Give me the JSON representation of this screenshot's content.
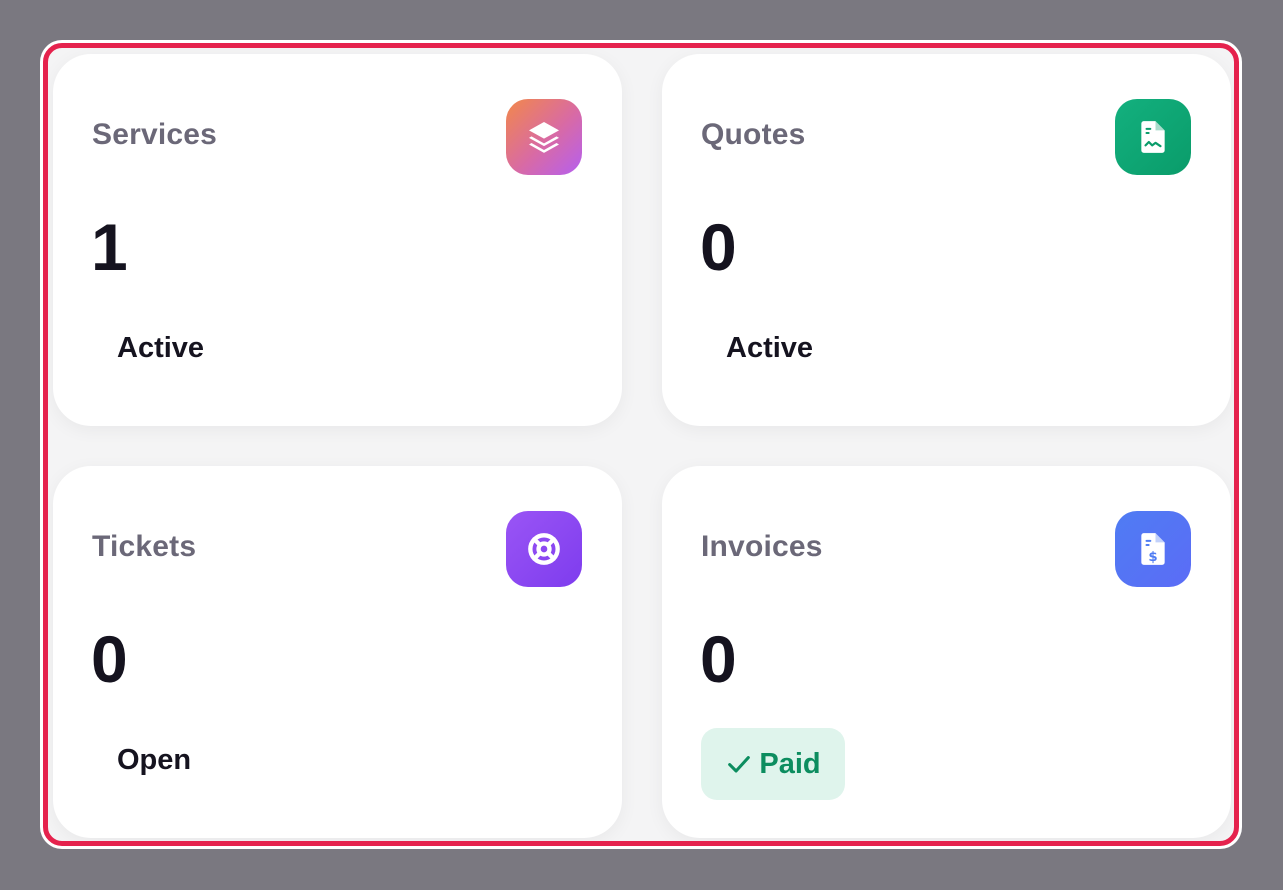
{
  "cards": {
    "services": {
      "title": "Services",
      "count": "1",
      "status": "Active",
      "icon": "layers-icon",
      "accent": [
        "#f2884a",
        "#b55ff0"
      ]
    },
    "quotes": {
      "title": "Quotes",
      "count": "0",
      "status": "Active",
      "icon": "document-chart-icon",
      "accent": [
        "#13b07e",
        "#0a9c6a"
      ]
    },
    "tickets": {
      "title": "Tickets",
      "count": "0",
      "status": "Open",
      "icon": "lifebuoy-icon",
      "accent": [
        "#9a55f5",
        "#7e3cee"
      ]
    },
    "invoices": {
      "title": "Invoices",
      "count": "0",
      "status": "Paid",
      "status_icon": "check-icon",
      "status_color": "#0c8d5f",
      "status_bg": "#dff4ec",
      "icon": "invoice-dollar-icon",
      "accent": [
        "#4f7cf3",
        "#5b6cf6"
      ]
    }
  },
  "colors": {
    "highlight_border": "#e5224d",
    "title_text": "#6b6878",
    "value_text": "#15131f"
  }
}
